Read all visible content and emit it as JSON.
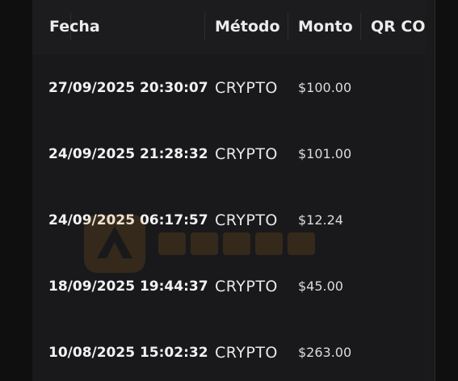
{
  "table": {
    "columns": [
      "Fecha",
      "Método",
      "Monto",
      "QR CO"
    ],
    "rows": [
      {
        "fecha": "27/09/2025 20:30:07",
        "metodo": "CRYPTO",
        "monto": "$100.00"
      },
      {
        "fecha": "24/09/2025 21:28:32",
        "metodo": "CRYPTO",
        "monto": "$101.00"
      },
      {
        "fecha": "24/09/2025 06:17:57",
        "metodo": "CRYPTO",
        "monto": "$12.24"
      },
      {
        "fecha": "18/09/2025 19:44:37",
        "metodo": "CRYPTO",
        "monto": "$45.00"
      },
      {
        "fecha": "10/08/2025 15:02:32",
        "metodo": "CRYPTO",
        "monto": "$263.00"
      }
    ]
  },
  "colors": {
    "background": "#0f0f10",
    "panel": "#1a1a1b",
    "text": "#f2f2f2",
    "watermark": "#d98a1f"
  },
  "icons": [
    "watermark-logo-icon"
  ]
}
